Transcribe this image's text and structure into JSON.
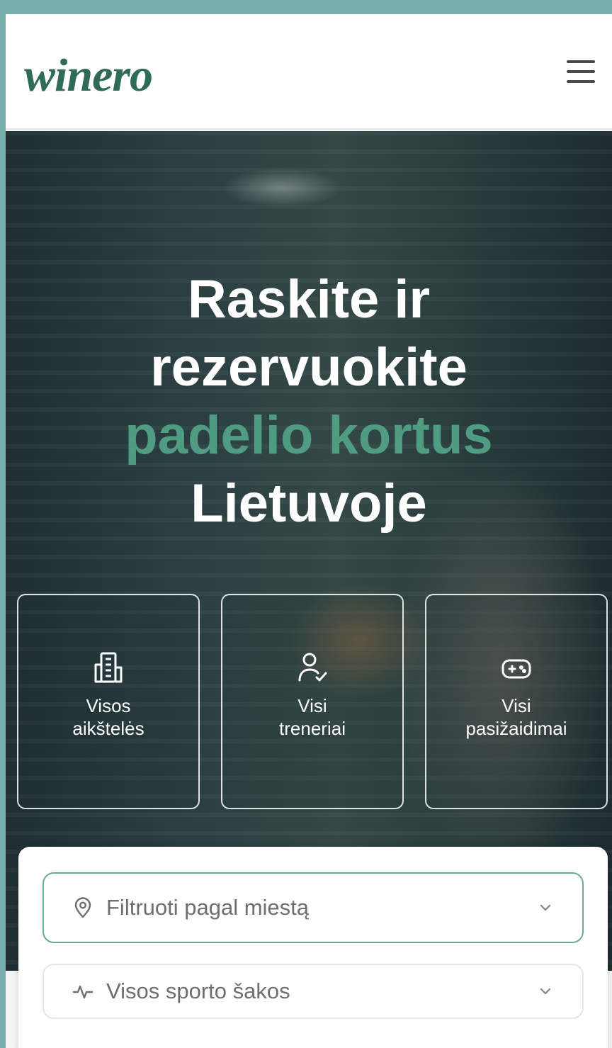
{
  "header": {
    "logo_text": "winero",
    "menu_icon": "hamburger-menu-icon"
  },
  "hero": {
    "title_line1": "Raskite ir",
    "title_line2": "rezervuokite",
    "title_accent": "padelio kortus",
    "title_line4": "Lietuvoje"
  },
  "categories": [
    {
      "label_line1": "Visos",
      "label_line2": "aikštelės",
      "icon": "building-icon"
    },
    {
      "label_line1": "Visi",
      "label_line2": "treneriai",
      "icon": "user-check-icon"
    },
    {
      "label_line1": "Visi",
      "label_line2": "pasižaidimai",
      "icon": "gamepad-icon"
    }
  ],
  "filters": {
    "city": {
      "text": "Filtruoti pagal miestą",
      "icon": "location-pin-icon"
    },
    "sport": {
      "text": "Visos sporto šakos",
      "icon": "activity-icon"
    }
  },
  "colors": {
    "brand_green": "#2f6b57",
    "accent_green": "#4f9c83",
    "outer_bg": "#76afac"
  }
}
